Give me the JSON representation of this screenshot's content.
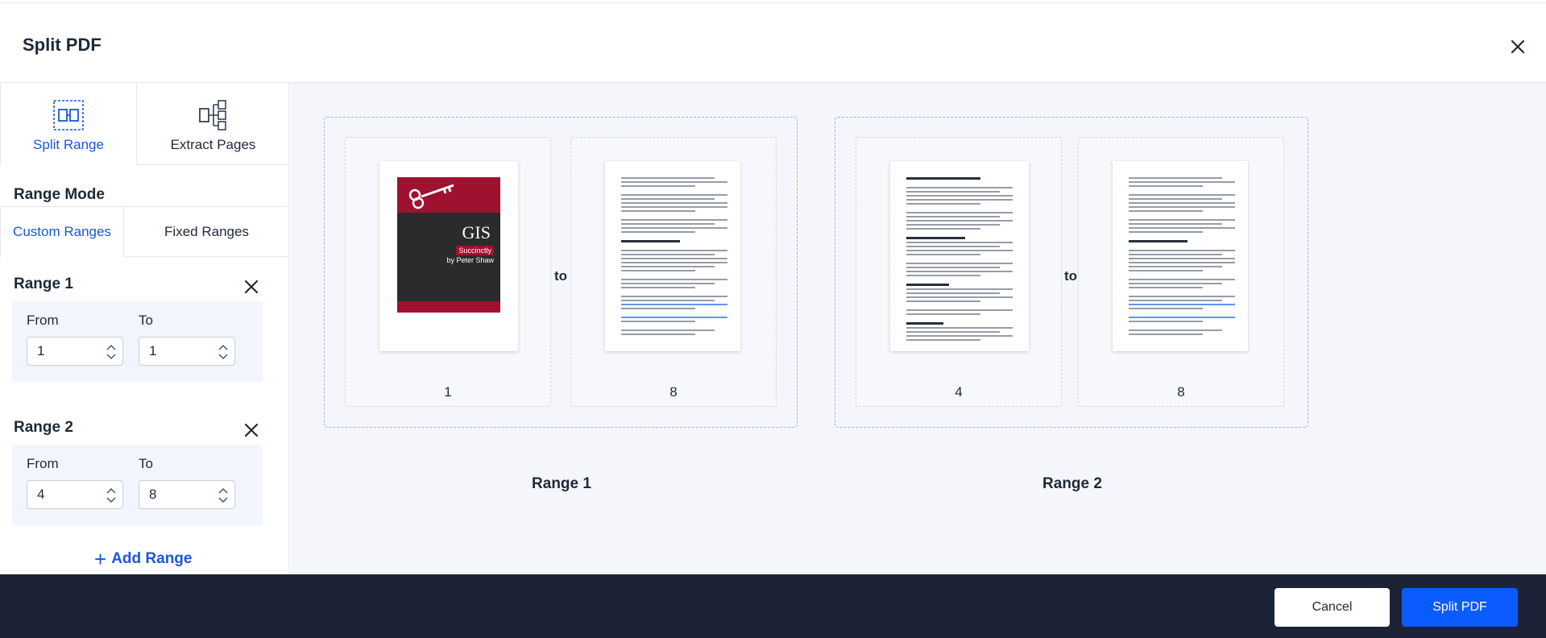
{
  "dialog": {
    "title": "Split PDF"
  },
  "sidebar": {
    "mode_tabs": [
      {
        "label": "Split Range",
        "icon": "split-range-icon",
        "active": true
      },
      {
        "label": "Extract Pages",
        "icon": "extract-pages-icon",
        "active": false
      }
    ],
    "range_mode_label": "Range Mode",
    "sub_tabs": [
      {
        "label": "Custom Ranges",
        "active": true
      },
      {
        "label": "Fixed Ranges",
        "active": false
      }
    ],
    "ranges": [
      {
        "title": "Range 1",
        "from_label": "From",
        "to_label": "To",
        "from": "1",
        "to": "1"
      },
      {
        "title": "Range 2",
        "from_label": "From",
        "to_label": "To",
        "from": "4",
        "to": "8"
      }
    ],
    "add_range_label": "Add Range"
  },
  "preview": {
    "connector": "to",
    "groups": [
      {
        "label": "Range 1",
        "start_page": "1",
        "end_page": "8"
      },
      {
        "label": "Range 2",
        "start_page": "4",
        "end_page": "8"
      }
    ],
    "cover": {
      "title": "GIS",
      "subtitle": "Succinctly",
      "author": "by Peter Shaw"
    }
  },
  "footer": {
    "cancel_label": "Cancel",
    "split_label": "Split PDF"
  },
  "colors": {
    "accent": "#1a56db",
    "primary_button": "#0a5cff",
    "footer_bg": "#1c2336",
    "cover_red": "#a0112f"
  }
}
